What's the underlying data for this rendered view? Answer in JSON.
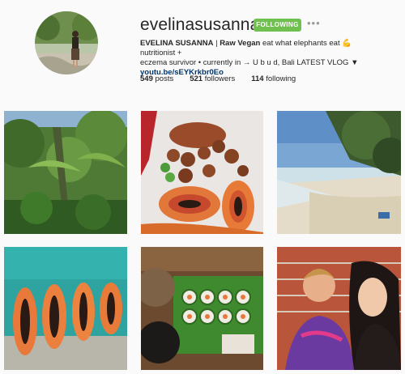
{
  "profile": {
    "username": "evelinasusannas",
    "follow_label": "FOLLOWING",
    "more_label": "•••",
    "bio_name": "EVELINA SUSANNA",
    "bio_sep": " | ",
    "bio_strong": "Raw Vegan",
    "bio_line1_rest": " eat what elephants eat 💪 nutritionist +",
    "bio_line2": "eczema survivor • currently in → U b u d, Bali LATEST VLOG ▼",
    "link": "youtu.be/sEYKrkbr0Eo"
  },
  "stats": {
    "posts_count": "549",
    "posts_label": "posts",
    "followers_count": "521",
    "followers_label": "followers",
    "following_count": "114",
    "following_label": "following"
  },
  "colors": {
    "follow_green": "#70c050",
    "link": "#003569"
  },
  "posts": [
    {
      "name": "jungle"
    },
    {
      "name": "papaya-sweet-potatoes"
    },
    {
      "name": "beach"
    },
    {
      "name": "papaya-halves-pool"
    },
    {
      "name": "sushi-rolls"
    },
    {
      "name": "couple-selfie"
    }
  ]
}
